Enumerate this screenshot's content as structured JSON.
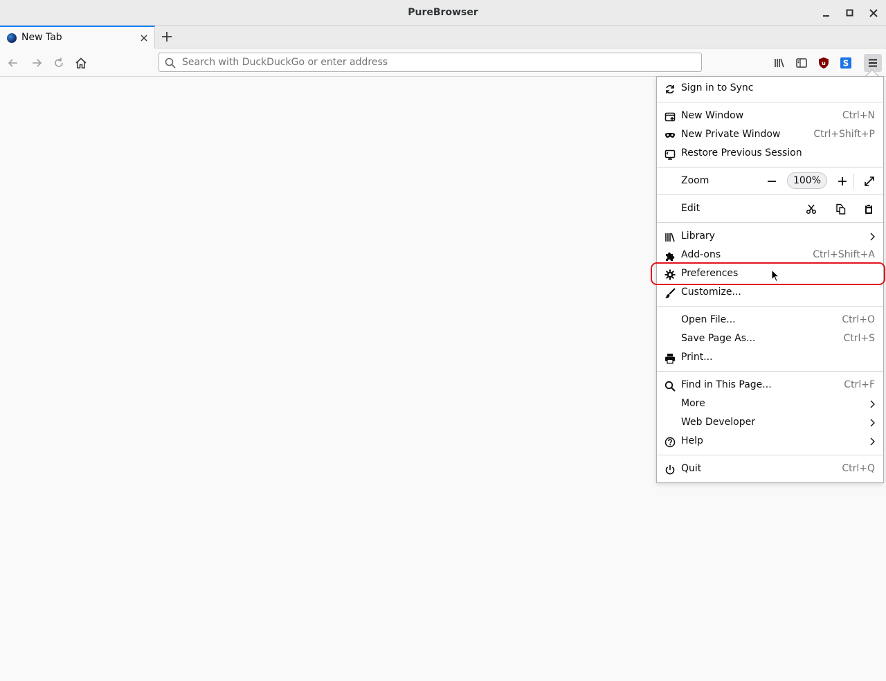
{
  "window": {
    "title": "PureBrowser"
  },
  "tabs": [
    {
      "title": "New Tab"
    }
  ],
  "urlbar": {
    "placeholder": "Search with DuckDuckGo or enter address"
  },
  "menu": {
    "sign_in": "Sign in to Sync",
    "new_window": {
      "label": "New Window",
      "shortcut": "Ctrl+N"
    },
    "new_private_window": {
      "label": "New Private Window",
      "shortcut": "Ctrl+Shift+P"
    },
    "restore_session": {
      "label": "Restore Previous Session"
    },
    "zoom": {
      "label": "Zoom",
      "value": "100%"
    },
    "edit": {
      "label": "Edit"
    },
    "library": {
      "label": "Library"
    },
    "addons": {
      "label": "Add-ons",
      "shortcut": "Ctrl+Shift+A"
    },
    "preferences": {
      "label": "Preferences"
    },
    "customize": {
      "label": "Customize..."
    },
    "open_file": {
      "label": "Open File...",
      "shortcut": "Ctrl+O"
    },
    "save_page": {
      "label": "Save Page As...",
      "shortcut": "Ctrl+S"
    },
    "print": {
      "label": "Print..."
    },
    "find": {
      "label": "Find in This Page...",
      "shortcut": "Ctrl+F"
    },
    "more": {
      "label": "More"
    },
    "web_developer": {
      "label": "Web Developer"
    },
    "help": {
      "label": "Help"
    },
    "quit": {
      "label": "Quit",
      "shortcut": "Ctrl+Q"
    }
  },
  "colors": {
    "accent": "#0a84ff",
    "highlight_ring": "#e3141d",
    "ublock": "#800000",
    "extension_s": "#1a73e8"
  }
}
